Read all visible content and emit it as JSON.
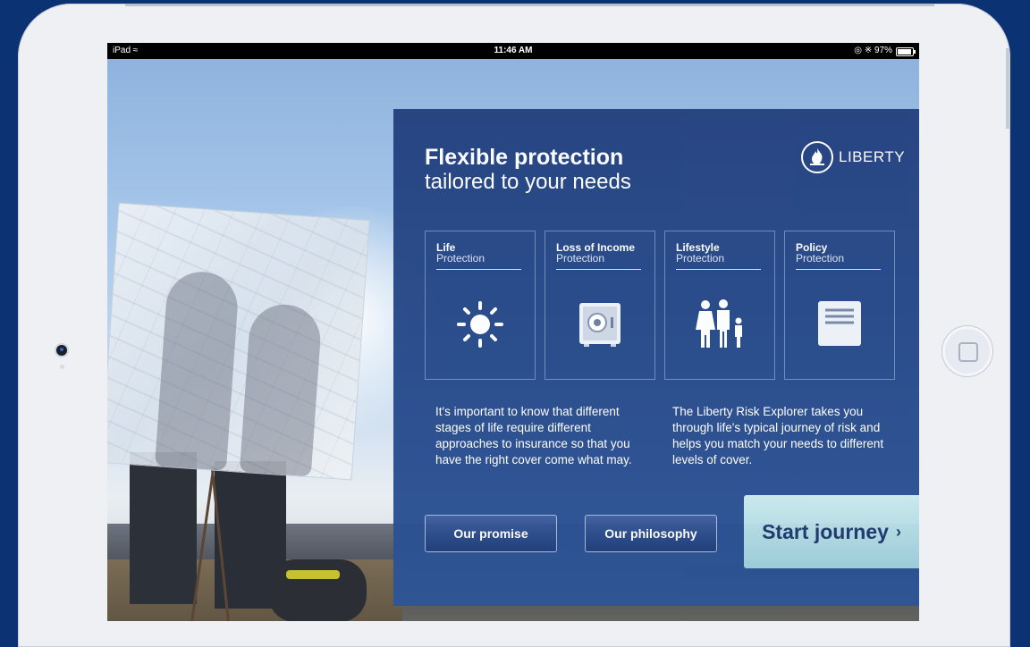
{
  "statusbar": {
    "device": "iPad",
    "time": "11:46 AM",
    "battery": "97%"
  },
  "hero": {
    "title": "Flexible protection",
    "subtitle": "tailored to your needs"
  },
  "logo": {
    "text": "LIBERTY"
  },
  "cards": [
    {
      "title": "Life",
      "subtitle": "Protection",
      "icon": "sun-icon"
    },
    {
      "title": "Loss of Income",
      "subtitle": "Protection",
      "icon": "safe-icon"
    },
    {
      "title": "Lifestyle",
      "subtitle": "Protection",
      "icon": "family-icon"
    },
    {
      "title": "Policy",
      "subtitle": "Protection",
      "icon": "document-icon"
    }
  ],
  "descriptions": {
    "left": "It's important to know that different stages of life require different approaches to insurance so that you have the right cover come what may.",
    "right": "The Liberty Risk Explorer takes you through life's typical journey of risk and helps you match your needs to different levels of cover."
  },
  "buttons": {
    "promise": "Our promise",
    "philosophy": "Our philosophy",
    "start": "Start journey",
    "start_chevron": "›"
  },
  "colors": {
    "panel": "#274a8a",
    "frame": "#0b3272",
    "start_button": "#b4dde6",
    "start_text": "#1f3a6e"
  }
}
